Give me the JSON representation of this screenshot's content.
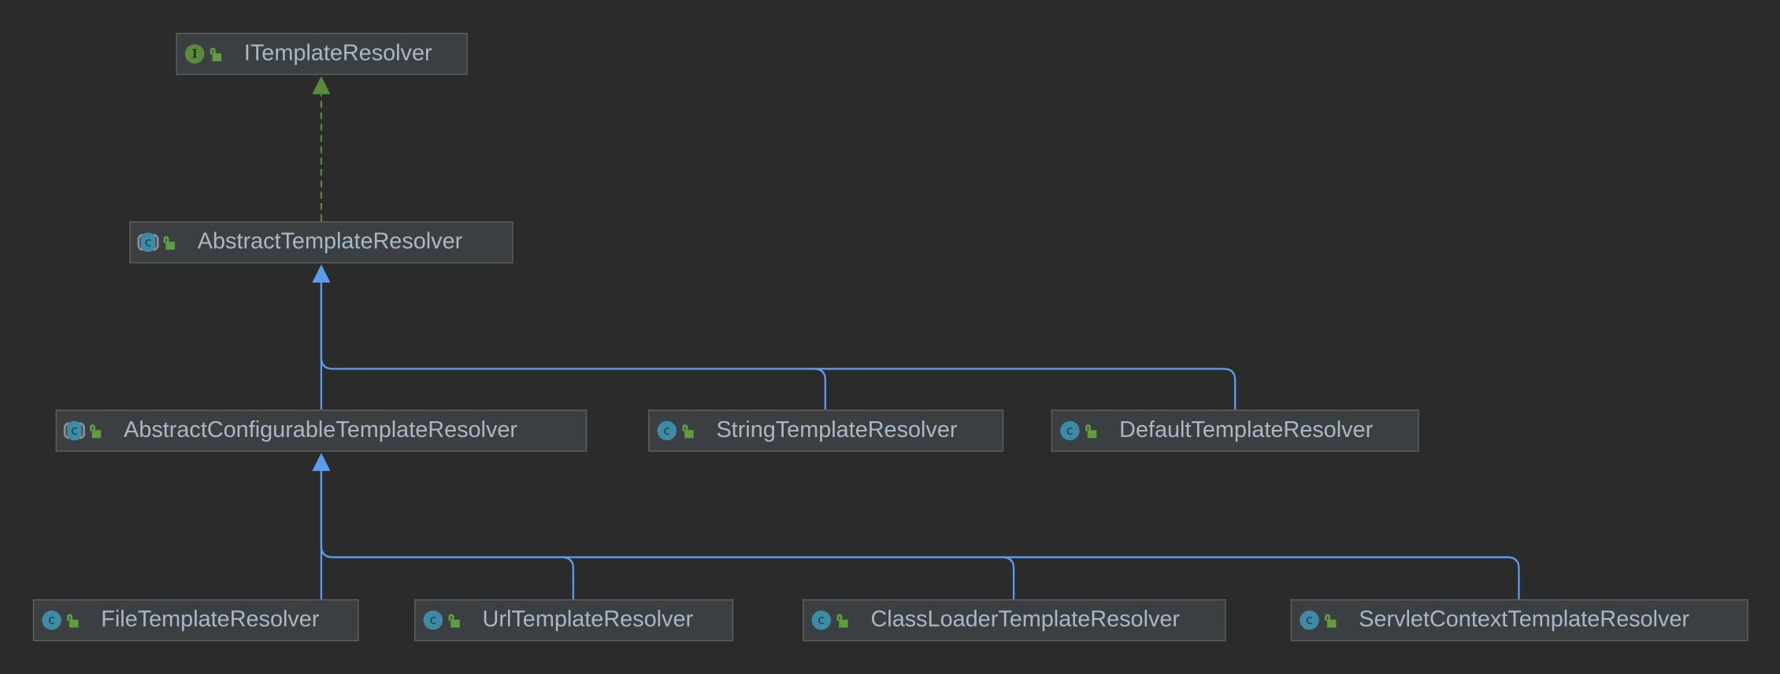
{
  "colors": {
    "background": "#2b2b2b",
    "node_fill": "#3c3f41",
    "text": "#a9b7c6",
    "implements_edge": "#5a8b3c",
    "extends_edge": "#5c9cf0",
    "class_icon": "#3d8ba5",
    "interface_icon": "#5a8b3c"
  },
  "nodes": {
    "itemplateresolver": {
      "label": "ITemplateResolver",
      "kind": "interface",
      "icon_letter": "I"
    },
    "abstracttemplateresolver": {
      "label": "AbstractTemplateResolver",
      "kind": "abstract-class",
      "icon_letter": "c"
    },
    "abstractconfigurable": {
      "label": "AbstractConfigurableTemplateResolver",
      "kind": "abstract-class",
      "icon_letter": "c"
    },
    "string": {
      "label": "StringTemplateResolver",
      "kind": "class",
      "icon_letter": "c"
    },
    "default": {
      "label": "DefaultTemplateResolver",
      "kind": "class",
      "icon_letter": "c"
    },
    "file": {
      "label": "FileTemplateResolver",
      "kind": "class",
      "icon_letter": "c"
    },
    "url": {
      "label": "UrlTemplateResolver",
      "kind": "class",
      "icon_letter": "c"
    },
    "classloader": {
      "label": "ClassLoaderTemplateResolver",
      "kind": "class",
      "icon_letter": "c"
    },
    "servletcontext": {
      "label": "ServletContextTemplateResolver",
      "kind": "class",
      "icon_letter": "c"
    }
  },
  "edges": [
    {
      "from": "AbstractTemplateResolver",
      "to": "ITemplateResolver",
      "type": "implements"
    },
    {
      "from": "AbstractConfigurableTemplateResolver",
      "to": "AbstractTemplateResolver",
      "type": "extends"
    },
    {
      "from": "StringTemplateResolver",
      "to": "AbstractTemplateResolver",
      "type": "extends"
    },
    {
      "from": "DefaultTemplateResolver",
      "to": "AbstractTemplateResolver",
      "type": "extends"
    },
    {
      "from": "FileTemplateResolver",
      "to": "AbstractConfigurableTemplateResolver",
      "type": "extends"
    },
    {
      "from": "UrlTemplateResolver",
      "to": "AbstractConfigurableTemplateResolver",
      "type": "extends"
    },
    {
      "from": "ClassLoaderTemplateResolver",
      "to": "AbstractConfigurableTemplateResolver",
      "type": "extends"
    },
    {
      "from": "ServletContextTemplateResolver",
      "to": "AbstractConfigurableTemplateResolver",
      "type": "extends"
    }
  ]
}
